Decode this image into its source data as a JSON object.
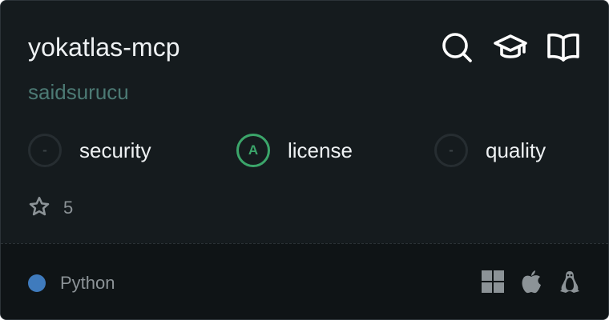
{
  "card": {
    "title": "yokatlas-mcp",
    "owner": "saidsurucu"
  },
  "header_icons": [
    {
      "name": "search-icon"
    },
    {
      "name": "graduation-cap-icon"
    },
    {
      "name": "book-icon"
    }
  ],
  "scores": [
    {
      "grade": "-",
      "label": "security"
    },
    {
      "grade": "A",
      "label": "license"
    },
    {
      "grade": "-",
      "label": "quality"
    }
  ],
  "stars": {
    "count": "5",
    "icon": "star-icon"
  },
  "footer": {
    "language": "Python",
    "language_color": "#3f7bbd",
    "platforms": [
      "windows-icon",
      "apple-icon",
      "linux-icon"
    ]
  },
  "colors": {
    "background": "#151b1e",
    "footer_background": "#0f1416",
    "owner_text": "#4c7a74",
    "grade_a": "#3ba56a"
  }
}
